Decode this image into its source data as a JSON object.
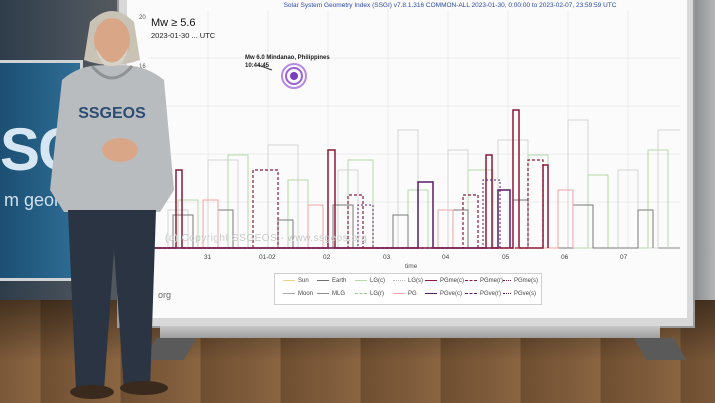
{
  "chart": {
    "title": "Solar System Geometry Index (SSGI) v7.8.1.316 COMMON-ALL 2023-01-30, 0:00:00 to 2023-02-07, 23:59:59 UTC",
    "magnitude": "Mw ≥ 5.6",
    "date_range": "2023-01-30 ... UTC",
    "event_name": "Mw 6.0 Mindanao, Philippines",
    "event_time": "10:44:45",
    "watermark": "(c) Copyright SSGEOS - www.ssgeos.org",
    "org_text": "org",
    "x_axis_label": "time",
    "y_ticks": [
      "20",
      "16"
    ]
  },
  "chart_data": {
    "type": "line",
    "x": [
      "31",
      "01-02",
      "02",
      "03",
      "04",
      "05",
      "06",
      "07"
    ],
    "xlabel": "time",
    "series": [
      {
        "name": "Sun",
        "color": "#e8d58a"
      },
      {
        "name": "Earth",
        "color": "#6e6e6e"
      },
      {
        "name": "LG(c)",
        "color": "#b7d9a8"
      },
      {
        "name": "LG(s)",
        "color": "#d0d0d0"
      },
      {
        "name": "PGme(c)",
        "color": "#8b1a3a"
      },
      {
        "name": "PGme(r)",
        "color": "#8b1a3a"
      },
      {
        "name": "PGme(s)",
        "color": "#8b1a3a"
      },
      {
        "name": "Moon",
        "color": "#aaaaaa"
      },
      {
        "name": "MLG",
        "color": "#8f8f8f"
      },
      {
        "name": "LG(r)",
        "color": "#a0c890"
      },
      {
        "name": "PG",
        "color": "#f7a7a7"
      },
      {
        "name": "PGve(c)",
        "color": "#5a1a6a"
      },
      {
        "name": "PGve(r)",
        "color": "#5a1a6a"
      },
      {
        "name": "PGve(s)",
        "color": "#5a1a6a"
      }
    ]
  },
  "legend": [
    {
      "label": "Sun",
      "color": "#e8d58a",
      "dash": "solid"
    },
    {
      "label": "Earth",
      "color": "#6e6e6e",
      "dash": "solid"
    },
    {
      "label": "LG(c)",
      "color": "#b7d9a8",
      "dash": "solid"
    },
    {
      "label": "LG(s)",
      "color": "#d0d0d0",
      "dash": "dotted"
    },
    {
      "label": "PGme(c)",
      "color": "#8b1a3a",
      "dash": "solid"
    },
    {
      "label": "PGme(r)",
      "color": "#8b1a3a",
      "dash": "dashed"
    },
    {
      "label": "PGme(s)",
      "color": "#8b1a3a",
      "dash": "dotted"
    },
    {
      "label": "Moon",
      "color": "#aaaaaa",
      "dash": "solid"
    },
    {
      "label": "MLG",
      "color": "#8f8f8f",
      "dash": "solid"
    },
    {
      "label": "LG(r)",
      "color": "#a0c890",
      "dash": "dashed"
    },
    {
      "label": "PG",
      "color": "#f7a7a7",
      "dash": "solid"
    },
    {
      "label": "PGve(c)",
      "color": "#5a1a6a",
      "dash": "solid"
    },
    {
      "label": "PGve(r)",
      "color": "#5a1a6a",
      "dash": "dashed"
    },
    {
      "label": "PGve(s)",
      "color": "#5a1a6a",
      "dash": "dotted"
    }
  ],
  "side_panel": {
    "logo": "SGE",
    "subtitle": "m geomet"
  },
  "presenter": {
    "hoodie_text": "SSGEOS"
  }
}
